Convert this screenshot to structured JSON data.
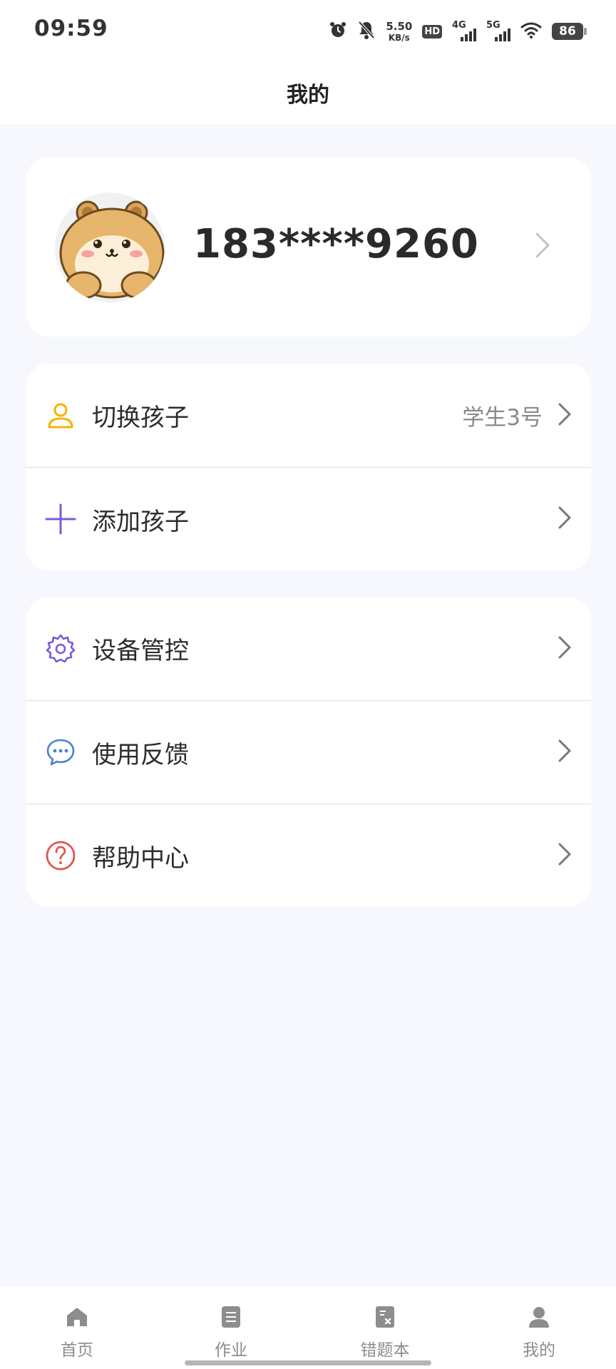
{
  "status_bar": {
    "time": "09:59",
    "net_speed_value": "5.50",
    "net_speed_unit": "KB/s",
    "hd_label": "HD",
    "signal_1_label": "4G",
    "signal_2_label": "5G",
    "battery": "86"
  },
  "header": {
    "title": "我的"
  },
  "profile": {
    "phone": "183****9260",
    "avatar_icon": "hamster-avatar"
  },
  "kids_menu": [
    {
      "icon": "person-icon",
      "label": "切换孩子",
      "value": "学生3号",
      "color": "#f5b400"
    },
    {
      "icon": "plus-icon",
      "label": "添加孩子",
      "value": "",
      "color": "#7a5ad8"
    }
  ],
  "tools_menu": [
    {
      "icon": "gear-icon",
      "label": "设备管控",
      "color": "#7a5ad8"
    },
    {
      "icon": "chat-bubble-icon",
      "label": "使用反馈",
      "color": "#4a7fd0"
    },
    {
      "icon": "question-circle-icon",
      "label": "帮助中心",
      "color": "#e0554f"
    }
  ],
  "tabbar": {
    "tabs": [
      {
        "label": "首页",
        "icon": "home-icon"
      },
      {
        "label": "作业",
        "icon": "document-icon"
      },
      {
        "label": "错题本",
        "icon": "mistake-book-icon"
      },
      {
        "label": "我的",
        "icon": "person-icon"
      }
    ],
    "inactive_color": "#8d8d8d"
  }
}
